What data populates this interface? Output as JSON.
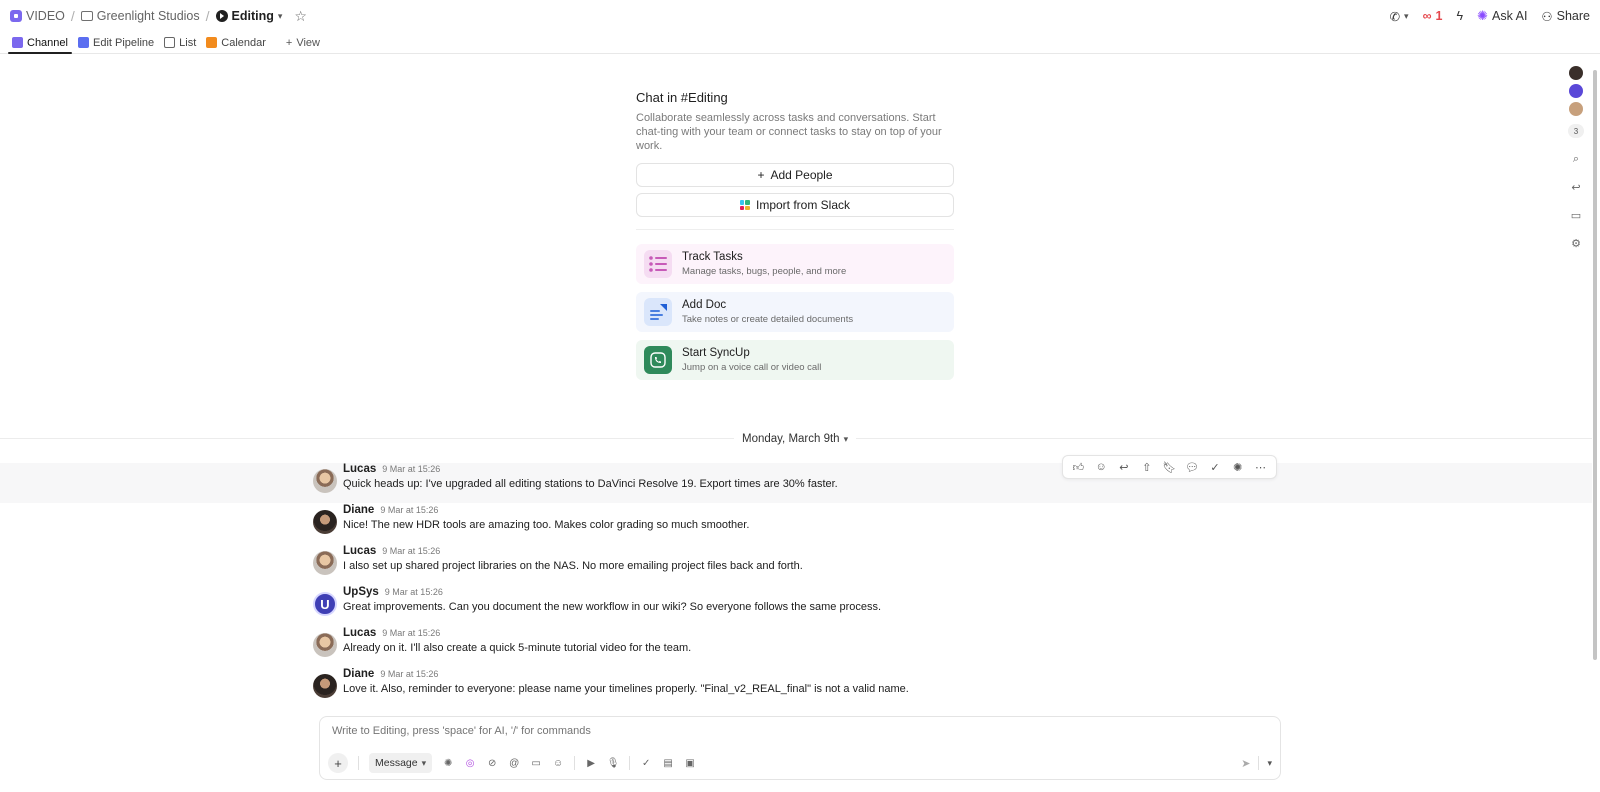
{
  "breadcrumb": {
    "items": [
      {
        "label": "VIDEO"
      },
      {
        "label": "Greenlight Studios"
      },
      {
        "label": "Editing"
      }
    ]
  },
  "topbar": {
    "notification_count": "1",
    "ask_ai_label": "Ask AI",
    "share_label": "Share"
  },
  "tabs": [
    {
      "label": "Channel",
      "active": true
    },
    {
      "label": "Edit Pipeline"
    },
    {
      "label": "List"
    },
    {
      "label": "Calendar"
    },
    {
      "label": "View"
    }
  ],
  "intro": {
    "title": "Chat in #Editing",
    "description": "Collaborate seamlessly across tasks and conversations. Start chat-ting with your team or connect tasks to stay on top of your work.",
    "add_people_label": "Add People",
    "import_slack_label": "Import from Slack",
    "cards": [
      {
        "title": "Track Tasks",
        "subtitle": "Manage tasks, bugs, people, and more"
      },
      {
        "title": "Add Doc",
        "subtitle": "Take notes or create detailed documents"
      },
      {
        "title": "Start SyncUp",
        "subtitle": "Jump on a voice call or video call"
      }
    ]
  },
  "date_divider": "Monday, March 9th",
  "messages": [
    {
      "author": "Lucas",
      "time": "9 Mar at 15:26",
      "text": "Quick heads up: I've upgraded all editing stations to DaVinci Resolve 19. Export times are 30% faster."
    },
    {
      "author": "Diane",
      "time": "9 Mar at 15:26",
      "text": "Nice! The new HDR tools are amazing too. Makes color grading so much smoother."
    },
    {
      "author": "Lucas",
      "time": "9 Mar at 15:26",
      "text": "I also set up shared project libraries on the NAS. No more emailing project files back and forth."
    },
    {
      "author": "UpSys",
      "time": "9 Mar at 15:26",
      "text": "Great improvements. Can you document the new workflow in our wiki? So everyone follows the same process."
    },
    {
      "author": "Lucas",
      "time": "9 Mar at 15:26",
      "text": "Already on it. I'll also create a quick 5-minute tutorial video for the team."
    },
    {
      "author": "Diane",
      "time": "9 Mar at 15:26",
      "text": "Love it. Also, reminder to everyone: please name your timelines properly. \"Final_v2_REAL_final\" is not a valid name."
    }
  ],
  "composer": {
    "placeholder": "Write to Editing, press 'space' for AI, '/' for commands",
    "mode_label": "Message"
  },
  "rail": {
    "member_count": "3"
  },
  "avatars": {
    "upsys_initial": "U"
  },
  "colors": {
    "accent": "#7b68ee",
    "notification": "#e5484d",
    "syncup_green": "#2f8a5b"
  }
}
